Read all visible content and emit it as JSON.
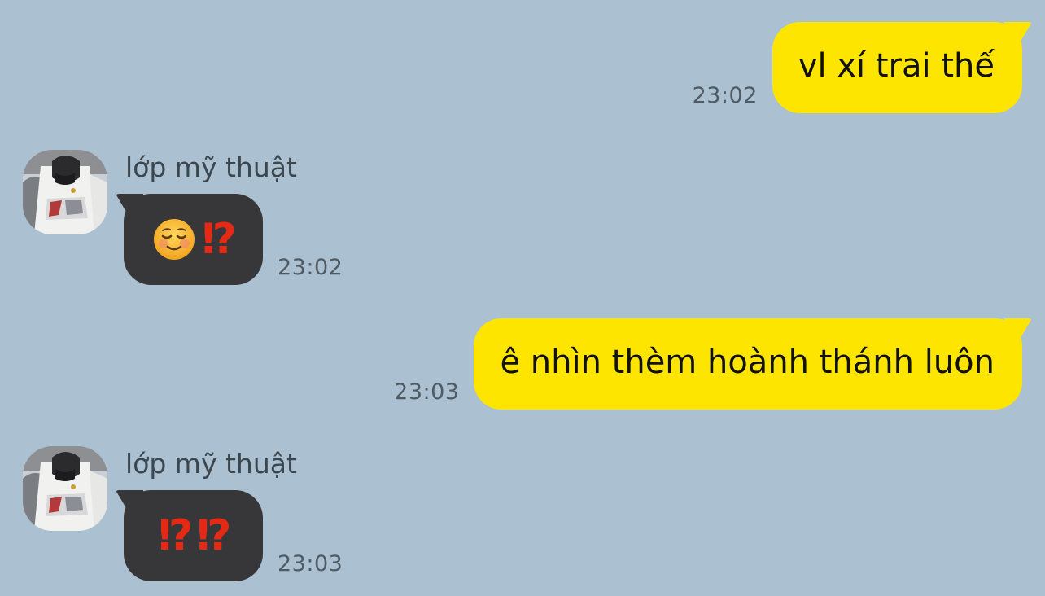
{
  "messages": [
    {
      "id": "m1",
      "direction": "outgoing",
      "text": "vl xí trai thế",
      "time": "23:02"
    },
    {
      "id": "m2",
      "direction": "incoming",
      "sender": "lớp mỹ thuật",
      "emoji": [
        "smiling-blushing-face",
        "interrobang"
      ],
      "interrobang": "⁉",
      "time": "23:02"
    },
    {
      "id": "m3",
      "direction": "outgoing",
      "text": "ê nhìn thèm hoành thánh luôn",
      "time": "23:03"
    },
    {
      "id": "m4",
      "direction": "incoming",
      "sender": "lớp mỹ thuật",
      "emoji": [
        "interrobang",
        "interrobang"
      ],
      "interrobang": "⁉",
      "time": "23:03"
    }
  ],
  "colors": {
    "background": "#abc1d1",
    "outgoing_bubble": "#fee500",
    "incoming_bubble": "#373739",
    "interrobang": "#e42a14",
    "timestamp": "#4f5a63"
  }
}
